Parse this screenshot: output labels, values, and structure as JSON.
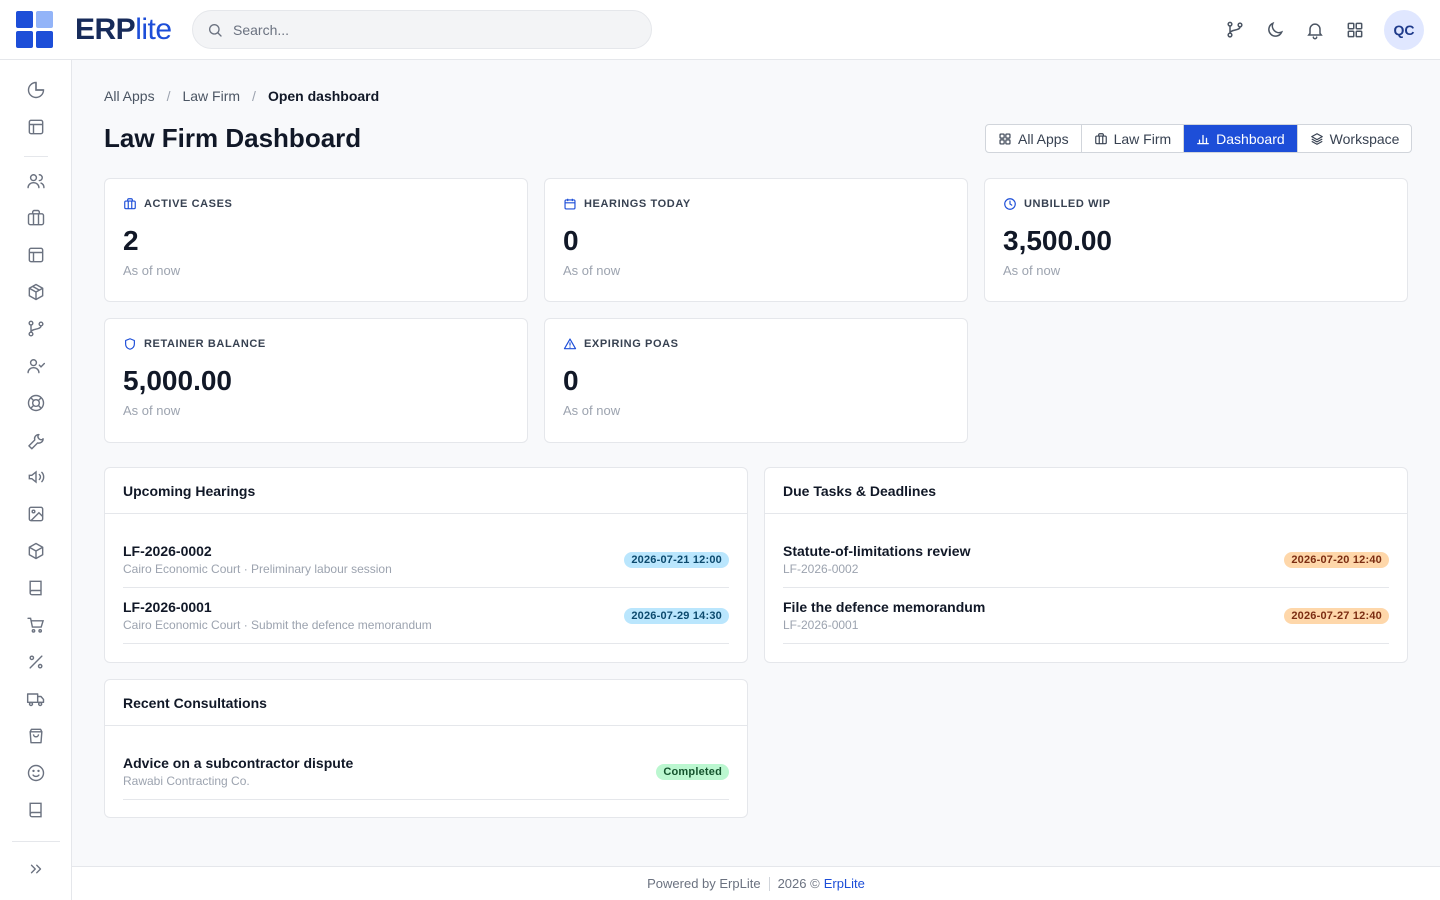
{
  "app": {
    "logo_part1": "ERP",
    "logo_part2": "lite",
    "colors": {
      "accent": "#1d4ed8",
      "logo_dark": "#172b5a",
      "logo_light": "#93b4f8"
    }
  },
  "search": {
    "placeholder": "Search...",
    "value": ""
  },
  "user": {
    "initials": "QC"
  },
  "topbar_icons": [
    "git-branch-icon",
    "moon-icon",
    "bell-icon",
    "apps-grid-icon"
  ],
  "sidebar": {
    "items": [
      "chart-pie-icon",
      "layout-icon",
      "users-icon",
      "briefcase-icon",
      "layout-icon",
      "package-icon",
      "git-branch-icon",
      "user-check-icon",
      "lifebuoy-icon",
      "wrench-icon",
      "megaphone-icon",
      "image-icon",
      "box-icon",
      "book-icon",
      "cart-icon",
      "percent-icon",
      "truck-icon",
      "shopping-bag-icon",
      "smile-icon",
      "book-icon",
      "book-open-icon"
    ],
    "expand": "chevrons-right-icon"
  },
  "breadcrumb": {
    "item1": "All Apps",
    "item2": "Law Firm",
    "current": "Open dashboard",
    "separator": "/"
  },
  "page_title": "Law Firm Dashboard",
  "nav_tabs": {
    "all_apps": "All Apps",
    "law_firm": "Law Firm",
    "dashboard": "Dashboard",
    "workspace": "Workspace",
    "active": "Dashboard"
  },
  "kpis": [
    {
      "label": "ACTIVE CASES",
      "value": "2",
      "sub": "As of now",
      "icon": "briefcase-icon"
    },
    {
      "label": "HEARINGS TODAY",
      "value": "0",
      "sub": "As of now",
      "icon": "calendar-icon"
    },
    {
      "label": "UNBILLED WIP",
      "value": "3,500.00",
      "sub": "As of now",
      "icon": "clock-icon"
    },
    {
      "label": "RETAINER BALANCE",
      "value": "5,000.00",
      "sub": "As of now",
      "icon": "shield-icon"
    },
    {
      "label": "EXPIRING POAS",
      "value": "0",
      "sub": "As of now",
      "icon": "alert-triangle-icon"
    }
  ],
  "hearings": {
    "title": "Upcoming Hearings",
    "rows": [
      {
        "title": "LF-2026-0002",
        "sub": "Cairo Economic Court · Preliminary labour session",
        "badge": "2026-07-21 12:00"
      },
      {
        "title": "LF-2026-0001",
        "sub": "Cairo Economic Court · Submit the defence memorandum",
        "badge": "2026-07-29 14:30"
      }
    ]
  },
  "tasks": {
    "title": "Due Tasks & Deadlines",
    "rows": [
      {
        "title": "Statute-of-limitations review",
        "sub": "LF-2026-0002",
        "badge": "2026-07-20 12:40"
      },
      {
        "title": "File the defence memorandum",
        "sub": "LF-2026-0001",
        "badge": "2026-07-27 12:40"
      }
    ]
  },
  "consultations": {
    "title": "Recent Consultations",
    "rows": [
      {
        "title": "Advice on a subcontractor dispute",
        "sub": "Rawabi Contracting Co.",
        "badge": "Completed"
      }
    ]
  },
  "footer": {
    "powered": "Powered by ErpLite",
    "year": "2026 ©",
    "link": "ErpLite"
  }
}
